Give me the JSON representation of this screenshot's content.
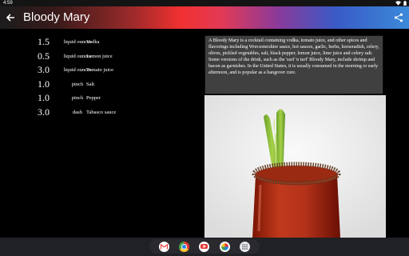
{
  "status": {
    "time": "4:59"
  },
  "header": {
    "title": "Bloody Mary"
  },
  "ingredients": [
    {
      "amount": "1.5",
      "unit": "liquid ounces",
      "name": "Vodka"
    },
    {
      "amount": "0.5",
      "unit": "liquid ounces",
      "name": "Lemon juice"
    },
    {
      "amount": "3.0",
      "unit": "liquid ounces",
      "name": "Tomato juice"
    },
    {
      "amount": "1.0",
      "unit": "pinch",
      "name": "Salt"
    },
    {
      "amount": "1.0",
      "unit": "pinch",
      "name": "Pepper"
    },
    {
      "amount": "3.0",
      "unit": "dash",
      "name": "Tabasco sauce"
    }
  ],
  "description": "A Bloody Mary is a cocktail containing vodka, tomato juice, and other spices and flavorings including Worcestershire sauce, hot sauces, garlic, herbs, horseradish, celery, olives, pickled vegetables, salt, black pepper, lemon juice, lime juice and celery salt. Some versions of the drink, such as the 'surf 'n turf' Bloody Mary, include shrimp and bacon as garnishes. In the United States, it is usually consumed in the morning or early afternoon, and is popular as a hangover cure.",
  "dock": {
    "apps": [
      "gmail-icon",
      "chrome-icon",
      "youtube-icon",
      "photos-icon",
      "app-drawer-icon"
    ]
  },
  "colors": {
    "appbar_left": "#1c1c1c",
    "appbar_mid": "#f03030",
    "appbar_right": "#3b8ad9",
    "description_bg": "#404040"
  }
}
